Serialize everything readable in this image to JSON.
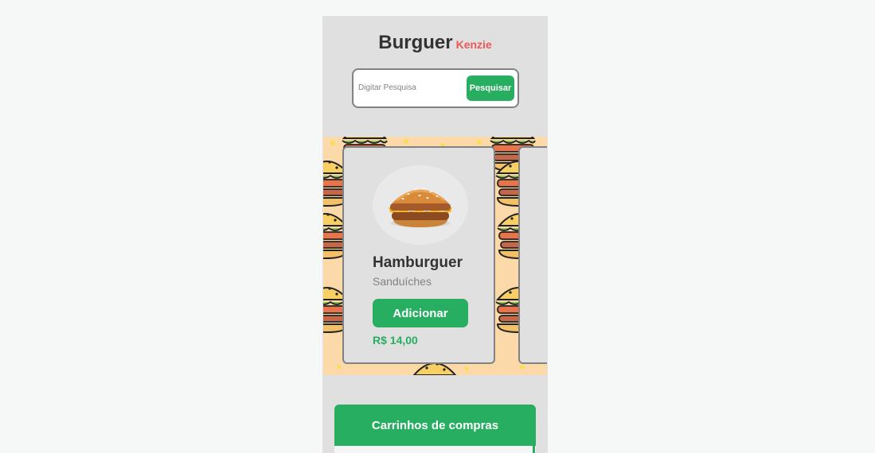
{
  "header": {
    "brand_main": "Burguer",
    "brand_sub": "Kenzie"
  },
  "search": {
    "placeholder": "Digitar Pesquisa",
    "value": "",
    "button_label": "Pesquisar"
  },
  "products": [
    {
      "name": "Hamburguer",
      "category": "Sanduíches",
      "add_label": "Adicionar",
      "price": "R$ 14,00",
      "icon": "burger-image"
    }
  ],
  "cart": {
    "title": "Carrinhos de compras"
  },
  "colors": {
    "primary": "#27ae60",
    "brand_accent": "#eb5757",
    "panel": "#e0e0e0",
    "text": "#333333",
    "muted": "#828282"
  }
}
